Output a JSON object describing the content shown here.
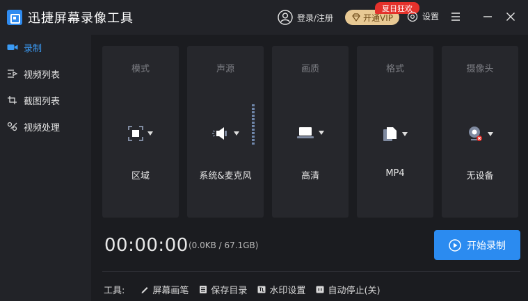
{
  "app": {
    "title": "迅捷屏幕录像工具"
  },
  "header": {
    "login_label": "登录/注册",
    "vip_label": "开通VIP",
    "promo_badge": "夏日狂欢",
    "settings_label": "设置"
  },
  "sidebar": {
    "items": [
      {
        "label": "录制",
        "icon": "video-camera-icon",
        "active": true
      },
      {
        "label": "视频列表",
        "icon": "video-list-icon",
        "active": false
      },
      {
        "label": "截图列表",
        "icon": "screenshot-list-icon",
        "active": false
      },
      {
        "label": "视频处理",
        "icon": "video-tools-icon",
        "active": false
      }
    ]
  },
  "cards": [
    {
      "title": "模式",
      "value": "区域",
      "icon": "region-icon"
    },
    {
      "title": "声源",
      "value": "系统&麦克风",
      "icon": "speaker-icon"
    },
    {
      "title": "画质",
      "value": "高清",
      "icon": "laptop-icon"
    },
    {
      "title": "格式",
      "value": "MP4",
      "icon": "file-icon"
    },
    {
      "title": "摄像头",
      "value": "无设备",
      "icon": "webcam-icon"
    }
  ],
  "recording": {
    "timer": "00:00:00",
    "storage": "(0.0KB / 67.1GB)",
    "start_label": "开始录制"
  },
  "tools": {
    "label": "工具:",
    "items": [
      {
        "label": "屏幕画笔",
        "icon": "pen-icon"
      },
      {
        "label": "保存目录",
        "icon": "folder-icon"
      },
      {
        "label": "水印设置",
        "icon": "watermark-icon"
      },
      {
        "label": "自动停止(关)",
        "icon": "auto-stop-icon"
      }
    ]
  },
  "colors": {
    "accent": "#2b8bf0",
    "vip_bg": "#e8c994",
    "promo_bg": "#e4312b"
  }
}
